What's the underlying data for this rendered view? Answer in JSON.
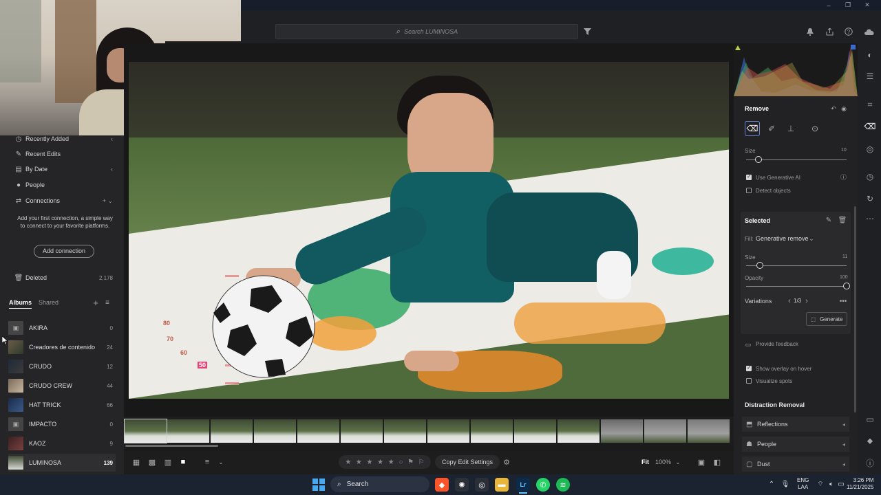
{
  "window": {
    "minimize": "–",
    "restore": "❐",
    "close": "✕"
  },
  "topbar": {
    "search_placeholder": "Search LUMINOSA"
  },
  "left_nav": [
    {
      "label": "Recently Added",
      "icon": "clock-icon",
      "right": "‹"
    },
    {
      "label": "Recent Edits",
      "icon": "edit-icon",
      "right": ""
    },
    {
      "label": "By Date",
      "icon": "calendar-icon",
      "right": "‹"
    },
    {
      "label": "People",
      "icon": "person-icon",
      "right": ""
    },
    {
      "label": "Connections",
      "icon": "connections-icon",
      "right": "+ ⌄"
    }
  ],
  "connections_hint": "Add your first connection, a simple way to connect to your favorite platforms.",
  "add_connection": "Add connection",
  "deleted": {
    "label": "Deleted",
    "count": "2,178"
  },
  "albums_tabs": {
    "albums": "Albums",
    "shared": "Shared"
  },
  "albums": [
    {
      "name": "AKIRA",
      "count": "0"
    },
    {
      "name": "Creadores de contenido",
      "count": "24"
    },
    {
      "name": "CRUDO",
      "count": "12"
    },
    {
      "name": "CRUDO CREW",
      "count": "44"
    },
    {
      "name": "HAT TRICK",
      "count": "66"
    },
    {
      "name": "IMPACTO",
      "count": "0"
    },
    {
      "name": "KAOZ",
      "count": "9"
    },
    {
      "name": "LUMINOSA",
      "count": "139"
    }
  ],
  "photo": {
    "mat_numbers": [
      "80",
      "70",
      "60",
      "50"
    ]
  },
  "bottombar": {
    "copy_edit": "Copy Edit Settings",
    "fit": "Fit",
    "zoom": "100%"
  },
  "remove_panel": {
    "title": "Remove",
    "size_label": "Size",
    "size_value": "10",
    "size_level": 0.12,
    "use_gen_ai": "Use Generative AI",
    "detect_objects": "Detect objects"
  },
  "selected_panel": {
    "title": "Selected",
    "fill_label": "Fill:",
    "fill_value": "Generative remove",
    "size_label": "Size",
    "size_value": "11",
    "size_level": 0.14,
    "opacity_label": "Opacity",
    "opacity_value": "100",
    "opacity_level": 1.0,
    "variations_label": "Variations",
    "variations_value": "1/3",
    "generate": "Generate"
  },
  "feedback": "Provide feedback",
  "show_overlay": "Show overlay on hover",
  "visualize_spots": "Visualize spots",
  "distraction": {
    "title": "Distraction Removal",
    "items": [
      "Reflections",
      "People",
      "Dust"
    ]
  },
  "taskbar": {
    "search": "Search",
    "lang": "ENG",
    "lang_sub": "LAA",
    "time": "3:26 PM",
    "date": "11/21/2025"
  }
}
